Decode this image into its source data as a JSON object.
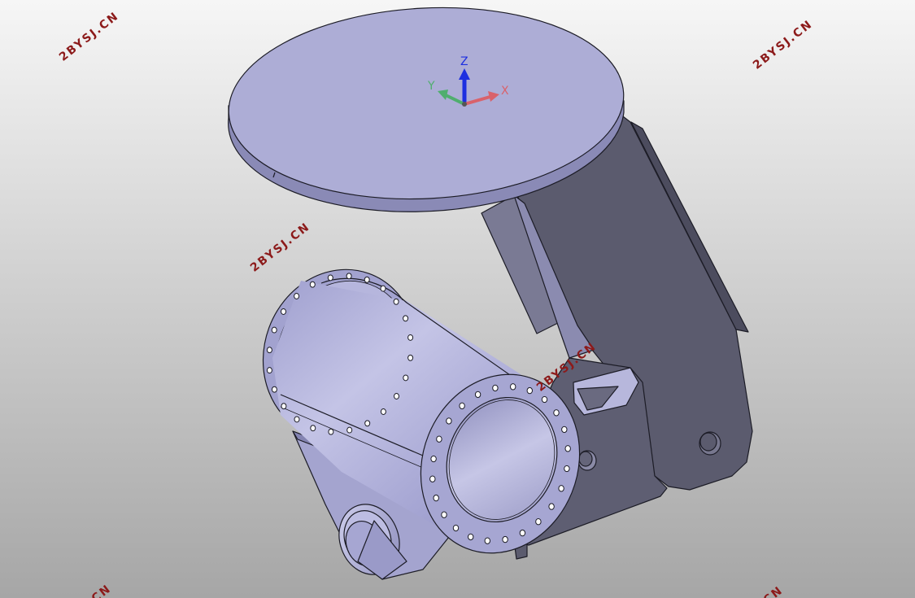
{
  "colors": {
    "background_top": "#f4f4f4",
    "background_bottom": "#a9a9a9",
    "part_light": "#b2b2da",
    "part_mid": "#9c9cc8",
    "part_dark": "#5b5b6e",
    "edge": "#1c1c26",
    "watermark": "#8c1a1a",
    "axis_x": "#d9626b",
    "axis_y": "#4fae6e",
    "axis_z": "#1d2fe0"
  },
  "triad": {
    "x_label": "X",
    "y_label": "Y",
    "z_label": "Z"
  },
  "watermark": {
    "text": "2BYSJ.CN",
    "text_partial": ".CN"
  },
  "icons": {
    "triad": "xyz-axis-triad-icon"
  }
}
